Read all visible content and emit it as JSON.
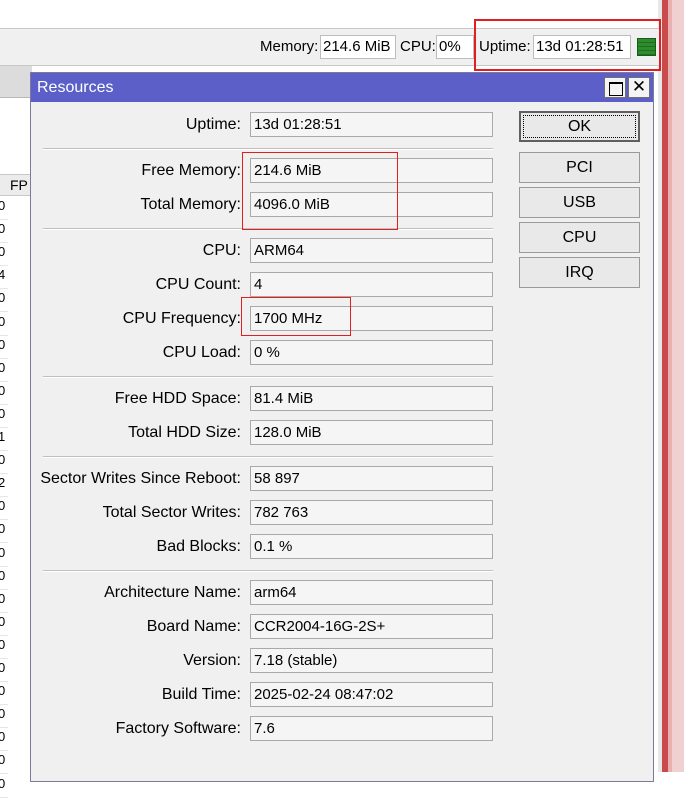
{
  "statusbar": {
    "memory_label": "Memory:",
    "memory_value": "214.6 MiB",
    "cpu_label": "CPU:",
    "cpu_value": "0%",
    "uptime_label": "Uptime:",
    "uptime_value": "13d 01:28:51",
    "indicator_icon": "status-bars-icon",
    "indicator_color": "#2e8b2e"
  },
  "background_table": {
    "header_fragment": "FP",
    "cells": [
      "0",
      "0",
      "0",
      "4",
      "0",
      "0",
      "0",
      "0",
      "0",
      "0",
      "1",
      "0",
      "2",
      "0",
      "0",
      "0",
      "0",
      "0",
      "0",
      "0",
      "0",
      "0",
      "0",
      "0",
      "0",
      "0"
    ]
  },
  "dialog": {
    "title": "Resources",
    "title_color": "#5b5fc7",
    "maximize_icon": "maximize-icon",
    "close_icon": "close-icon",
    "close_glyph": "✕",
    "fields": {
      "uptime": {
        "label": "Uptime:",
        "value": "13d 01:28:51"
      },
      "free_memory": {
        "label": "Free Memory:",
        "value": "214.6 MiB"
      },
      "total_memory": {
        "label": "Total Memory:",
        "value": "4096.0 MiB"
      },
      "cpu": {
        "label": "CPU:",
        "value": "ARM64"
      },
      "cpu_count": {
        "label": "CPU Count:",
        "value": "4"
      },
      "cpu_frequency": {
        "label": "CPU Frequency:",
        "value": "1700 MHz"
      },
      "cpu_load": {
        "label": "CPU Load:",
        "value": "0 %"
      },
      "free_hdd": {
        "label": "Free HDD Space:",
        "value": "81.4 MiB"
      },
      "total_hdd": {
        "label": "Total HDD Size:",
        "value": "128.0 MiB"
      },
      "sector_writes_since_reboot": {
        "label": "Sector Writes Since Reboot:",
        "value": "58 897"
      },
      "total_sector_writes": {
        "label": "Total Sector Writes:",
        "value": "782 763"
      },
      "bad_blocks": {
        "label": "Bad Blocks:",
        "value": "0.1 %"
      },
      "architecture_name": {
        "label": "Architecture Name:",
        "value": "arm64"
      },
      "board_name": {
        "label": "Board Name:",
        "value": "CCR2004-16G-2S+"
      },
      "version": {
        "label": "Version:",
        "value": "7.18 (stable)"
      },
      "build_time": {
        "label": "Build Time:",
        "value": "2025-02-24 08:47:02"
      },
      "factory_software": {
        "label": "Factory Software:",
        "value": "7.6"
      }
    },
    "buttons": {
      "ok": "OK",
      "pci": "PCI",
      "usb": "USB",
      "cpu": "CPU",
      "irq": "IRQ"
    }
  },
  "highlight_color": "#e02020"
}
